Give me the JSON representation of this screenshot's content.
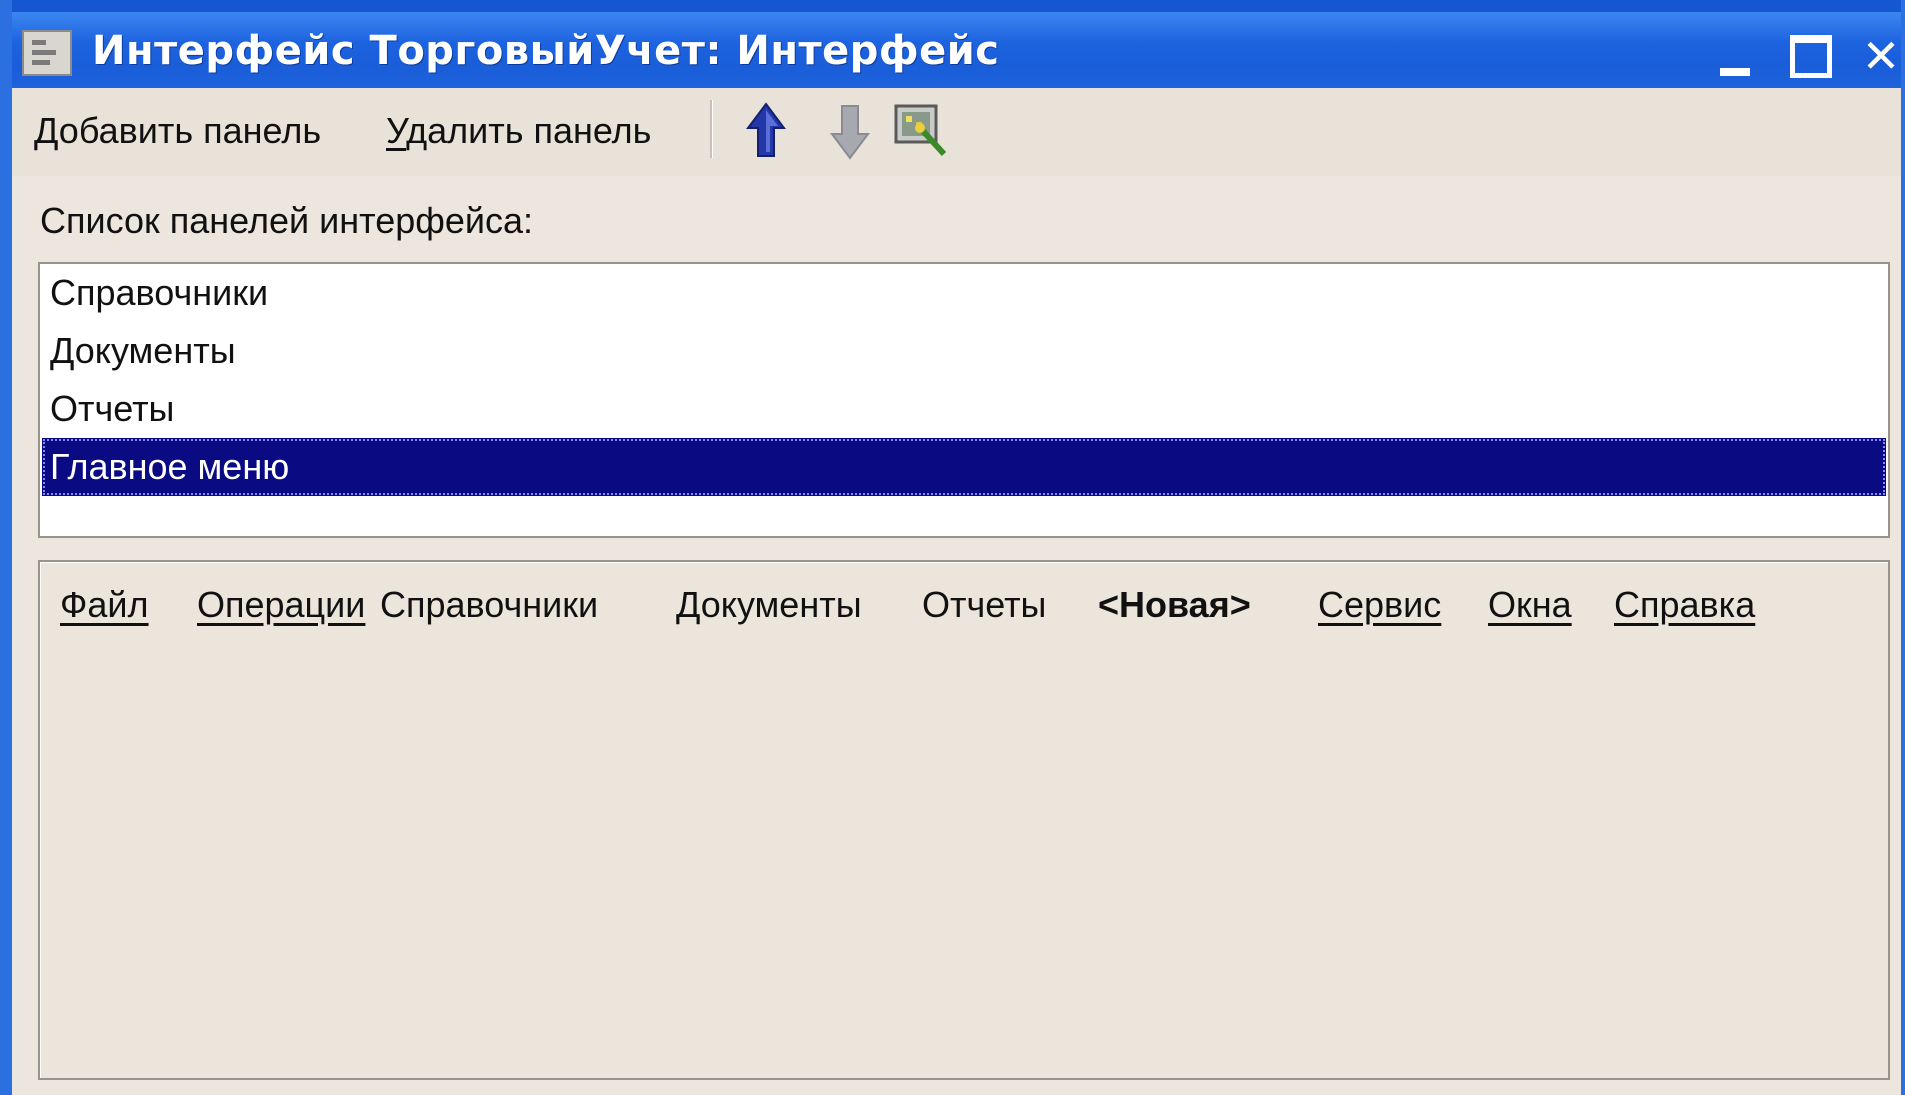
{
  "window": {
    "title": "Интерфейс ТорговыйУчет: Интерфейс",
    "buttons": {
      "minimize_icon": "minimize-icon",
      "maximize_icon": "maximize-icon",
      "close_label": "✕"
    }
  },
  "toolbar": {
    "add_panel_label": "Добавить панель",
    "remove_panel_label": "Удалить панель",
    "icons": [
      "arrow-up-icon",
      "arrow-down-icon",
      "wizard-icon"
    ]
  },
  "panels": {
    "label": "Список панелей интерфейса:",
    "items": [
      {
        "label": "Справочники",
        "selected": false
      },
      {
        "label": "Документы",
        "selected": false
      },
      {
        "label": "Отчеты",
        "selected": false
      },
      {
        "label": "Главное меню",
        "selected": true
      }
    ]
  },
  "menu_bar": {
    "items": [
      {
        "label": "Файл",
        "underlined": true,
        "bold": false
      },
      {
        "label": "Операции",
        "underlined": true,
        "bold": false
      },
      {
        "label": "Справочники",
        "underlined": false,
        "bold": false
      },
      {
        "label": "Документы",
        "underlined": false,
        "bold": false
      },
      {
        "label": "Отчеты",
        "underlined": false,
        "bold": false
      },
      {
        "label": "<Новая>",
        "underlined": false,
        "bold": true
      },
      {
        "label": "Сервис",
        "underlined": true,
        "bold": false
      },
      {
        "label": "Окна",
        "underlined": true,
        "bold": false
      },
      {
        "label": "Справка",
        "underlined": true,
        "bold": false
      }
    ]
  },
  "colors": {
    "titlebar": "#1d63e0",
    "window_bg": "#ece6de",
    "selection": "#0a0a82",
    "arrow_up": "#2437a8",
    "arrow_down_disabled": "#a8a8b0"
  }
}
